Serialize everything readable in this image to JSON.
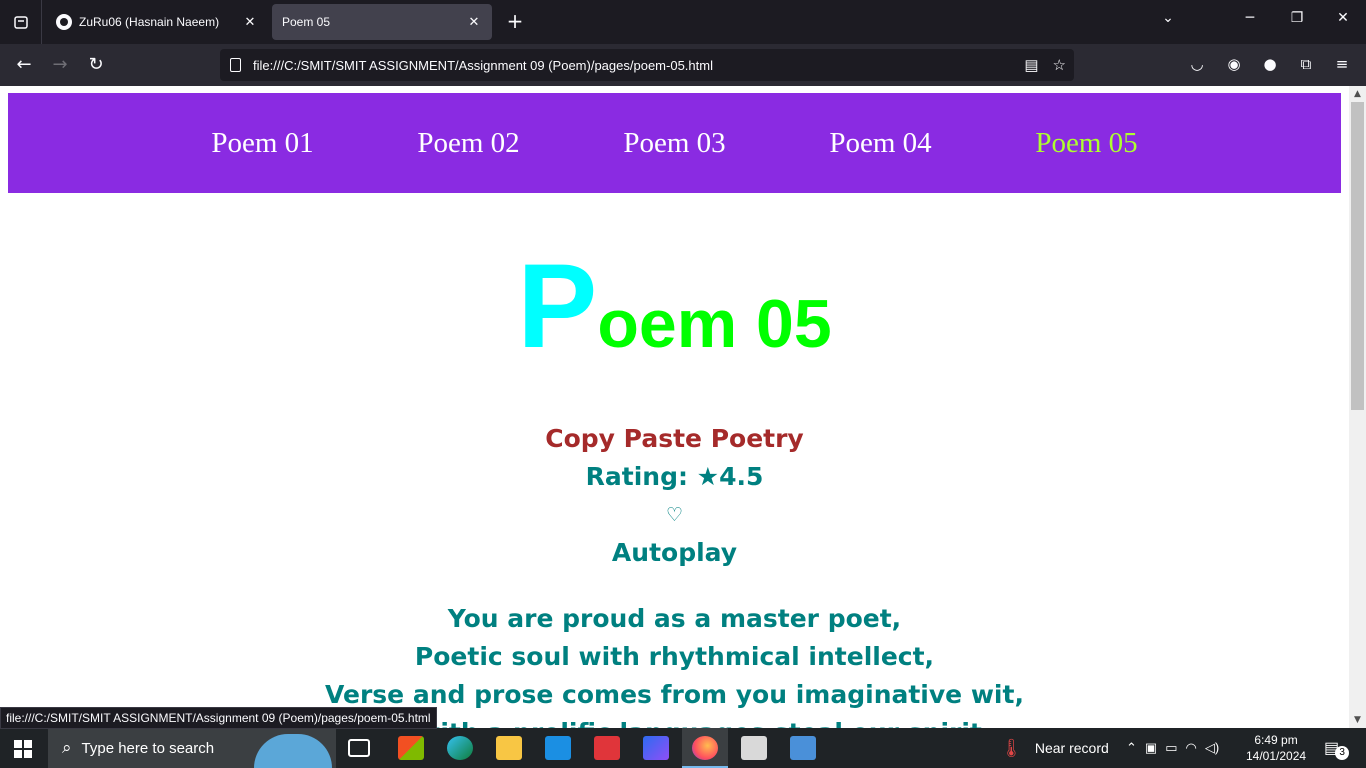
{
  "browser": {
    "tabs": [
      {
        "title": "ZuRu06 (Hasnain Naeem)",
        "active": false
      },
      {
        "title": "Poem 05",
        "active": true
      }
    ],
    "url": "file:///C:/SMIT/SMIT ASSIGNMENT/Assignment 09 (Poem)/pages/poem-05.html",
    "status_url": "file:///C:/SMIT/SMIT ASSIGNMENT/Assignment 09 (Poem)/pages/poem-05.html"
  },
  "site_nav": {
    "links": [
      "Poem 01",
      "Poem 02",
      "Poem 03",
      "Poem 04",
      "Poem 05"
    ],
    "current_index": 4,
    "current_color": "#adff2f"
  },
  "page": {
    "heading_initial": "P",
    "heading_rest": "oem 05",
    "author": "Copy Paste Poetry",
    "rating": "Rating: ★4.5",
    "heart": "♡",
    "autoplay": "Autoplay",
    "poem_lines": [
      "You are proud as a master poet,",
      "Poetic soul with rhythmical intellect,",
      "Verse and prose comes from you imaginative wit,",
      "Fed with a prolific languages steal our spirit,"
    ]
  },
  "taskbar": {
    "search_placeholder": "Type here to search",
    "weather": "Near record",
    "time": "6:49 pm",
    "date": "14/01/2024",
    "notifications": "3"
  },
  "colors": {
    "nav_bg": "#8a2be2",
    "heading_initial": "#00ffff",
    "heading_rest": "#00ff00",
    "author": "#a52a2a",
    "text": "#008080"
  }
}
